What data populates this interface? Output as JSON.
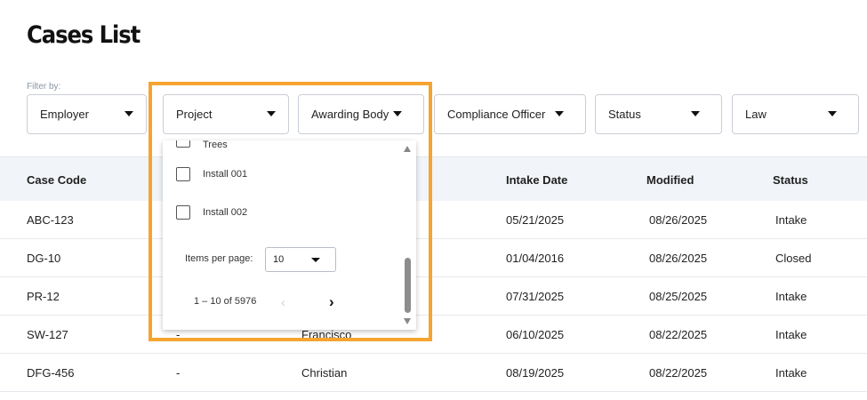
{
  "page": {
    "title": "Cases List",
    "filter_label": "Filter by:"
  },
  "filters": [
    {
      "label": "Employer"
    },
    {
      "label": "Project"
    },
    {
      "label": "Awarding Body"
    },
    {
      "label": "Compliance Officer"
    },
    {
      "label": "Status"
    },
    {
      "label": "Law"
    }
  ],
  "table": {
    "headers": [
      "Case Code",
      "Intake Date",
      "Modified",
      "Status"
    ],
    "rows": [
      {
        "code": "ABC-123",
        "col2": "",
        "col3": "",
        "intake": "05/21/2025",
        "modified": "08/26/2025",
        "status": "Intake"
      },
      {
        "code": "DG-10",
        "col2": "",
        "col3": "",
        "intake": "01/04/2016",
        "modified": "08/26/2025",
        "status": "Closed"
      },
      {
        "code": "PR-12",
        "col2": "",
        "col3": "",
        "intake": "07/31/2025",
        "modified": "08/25/2025",
        "status": "Intake"
      },
      {
        "code": "SW-127",
        "col2": "-",
        "col3": "Francisco",
        "intake": "06/10/2025",
        "modified": "08/22/2025",
        "status": "Intake"
      },
      {
        "code": "DFG-456",
        "col2": "-",
        "col3": "Christian",
        "intake": "08/19/2025",
        "modified": "08/22/2025",
        "status": "Intake"
      }
    ]
  },
  "project_dropdown": {
    "options": [
      {
        "label": "Trees",
        "checked": false
      },
      {
        "label": "Install 001",
        "checked": false
      },
      {
        "label": "Install 002",
        "checked": false
      }
    ],
    "items_per_page_label": "Items per page:",
    "items_per_page_value": "10",
    "range_label": "1 – 10 of 5976",
    "prev_icon": "chevron-left-icon",
    "next_icon": "chevron-right-icon"
  },
  "colors": {
    "highlight": "#f5a431",
    "header_bg": "#f1f4f8"
  }
}
